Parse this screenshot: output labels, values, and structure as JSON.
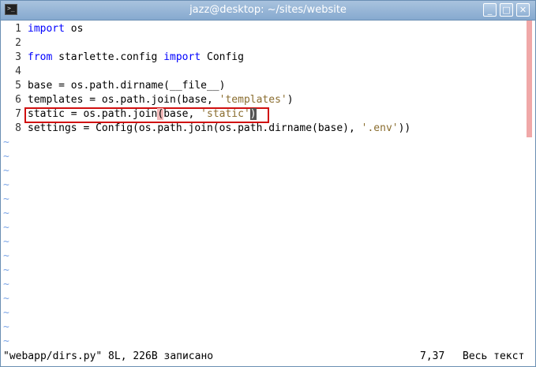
{
  "window": {
    "title": "jazz@desktop: ~/sites/website",
    "terminal_icon_glyph": ">_",
    "buttons": {
      "minimize": "_",
      "maximize": "□",
      "close": "✕"
    },
    "icons": [
      "terminal-icon",
      "minimize-icon",
      "maximize-icon",
      "close-icon"
    ]
  },
  "editor": {
    "lines": [
      {
        "num": "1",
        "segments": [
          {
            "t": "import",
            "c": "kw"
          },
          {
            "t": " os",
            "c": ""
          }
        ]
      },
      {
        "num": "2",
        "segments": []
      },
      {
        "num": "3",
        "segments": [
          {
            "t": "from",
            "c": "kw"
          },
          {
            "t": " starlette.config ",
            "c": ""
          },
          {
            "t": "import",
            "c": "kw"
          },
          {
            "t": " Config",
            "c": ""
          }
        ]
      },
      {
        "num": "4",
        "segments": []
      },
      {
        "num": "5",
        "segments": [
          {
            "t": "base = os.path.dirname(__file__)",
            "c": ""
          }
        ]
      },
      {
        "num": "6",
        "segments": [
          {
            "t": "templates = os.path.join(base, ",
            "c": ""
          },
          {
            "t": "'templates'",
            "c": "str"
          },
          {
            "t": ")",
            "c": ""
          }
        ]
      },
      {
        "num": "7",
        "segments": [
          {
            "t": "static = os.path.join",
            "c": ""
          },
          {
            "t": "(",
            "c": "paren-hl"
          },
          {
            "t": "base, ",
            "c": ""
          },
          {
            "t": "'static'",
            "c": "str"
          },
          {
            "t": ")",
            "c": "cursor"
          }
        ]
      },
      {
        "num": "8",
        "segments": [
          {
            "t": "settings = Config(os.path.join(os.path.dirname(base), ",
            "c": ""
          },
          {
            "t": "'.env'",
            "c": "str"
          },
          {
            "t": "))",
            "c": ""
          }
        ]
      }
    ],
    "tilde_char": "~",
    "tilde_count": 15,
    "colors": {
      "keyword": "#0000ff",
      "string": "#8a6d2f",
      "tilde": "#7aa4e6",
      "highlight_box": "#d01010",
      "scrollbar": "#f0a8a8"
    }
  },
  "statusline": {
    "message": "\"webapp/dirs.py\" 8L, 226B записано",
    "position": "7,37",
    "percent": "Весь текст"
  }
}
